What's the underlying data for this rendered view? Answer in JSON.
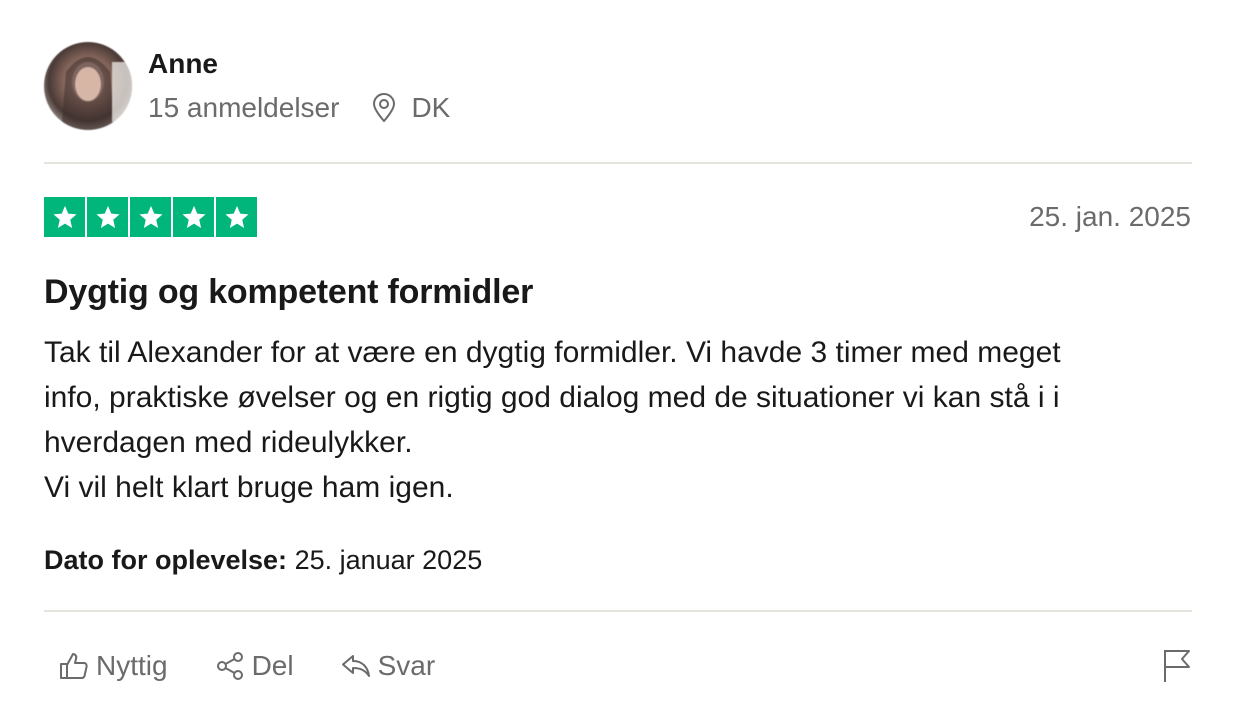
{
  "reviewer": {
    "name": "Anne",
    "review_count": "15 anmeldelser",
    "location": "DK",
    "avatar_icon": "avatar-photo-blurred"
  },
  "review": {
    "rating": 5,
    "rating_max": 5,
    "star_color": "#00b67a",
    "date": "25. jan. 2025",
    "title": "Dygtig og kompetent formidler",
    "body_lines": [
      "Tak til Alexander for at være en dygtig formidler. Vi havde 3 timer med meget",
      "info, praktiske øvelser og en rigtig god dialog med de situationer vi kan stå i i",
      "hverdagen med rideulykker.",
      "Vi vil helt klart bruge ham igen."
    ],
    "experience_label": "Dato for oplevelse:",
    "experience_date": "25. januar 2025"
  },
  "actions": {
    "useful_label": "Nyttig",
    "share_label": "Del",
    "reply_label": "Svar",
    "icons": [
      "thumbs-up-icon",
      "share-icon",
      "reply-icon",
      "flag-icon"
    ]
  }
}
